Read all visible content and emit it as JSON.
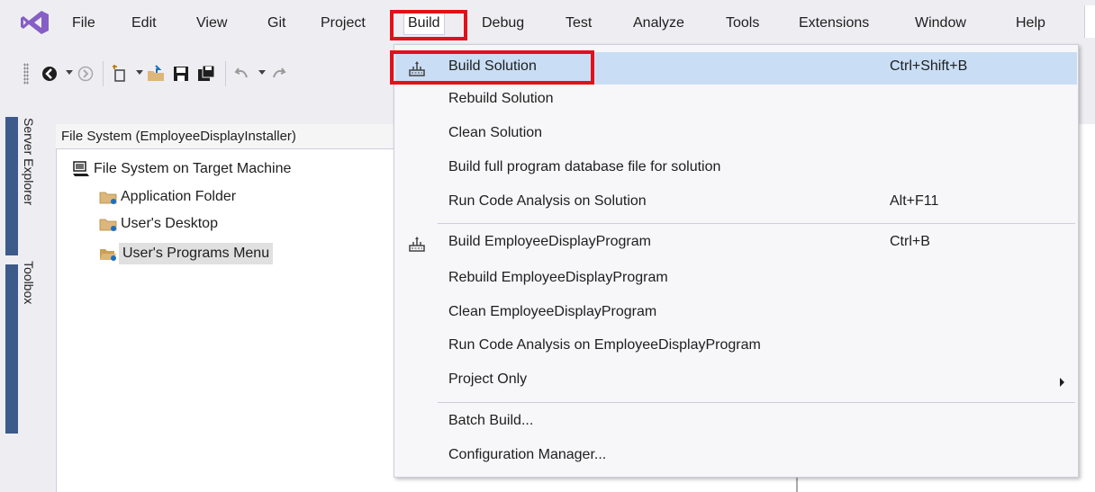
{
  "menubar": {
    "items": [
      {
        "label": "File"
      },
      {
        "label": "Edit"
      },
      {
        "label": "View"
      },
      {
        "label": "Git"
      },
      {
        "label": "Project"
      },
      {
        "label": "Build"
      },
      {
        "label": "Debug"
      },
      {
        "label": "Test"
      },
      {
        "label": "Analyze"
      },
      {
        "label": "Tools"
      },
      {
        "label": "Extensions"
      },
      {
        "label": "Window"
      },
      {
        "label": "Help"
      }
    ],
    "active": "Build"
  },
  "side_tabs": {
    "server_explorer": "Server Explorer",
    "toolbox": "Toolbox"
  },
  "document": {
    "tab_title": "File System (EmployeeDisplayInstaller)",
    "tree": [
      {
        "label": "File System on Target Machine",
        "icon": "computer-icon"
      },
      {
        "label": "Application Folder",
        "icon": "folder-icon"
      },
      {
        "label": "User's Desktop",
        "icon": "folder-icon"
      },
      {
        "label": "User's Programs Menu",
        "icon": "folder-icon",
        "selected": true
      }
    ]
  },
  "build_menu": {
    "items": [
      {
        "label": "Build Solution",
        "shortcut": "Ctrl+Shift+B",
        "icon": "build-icon",
        "highlighted": true
      },
      {
        "label": "Rebuild Solution",
        "shortcut": ""
      },
      {
        "label": "Clean Solution",
        "shortcut": ""
      },
      {
        "label": "Build full program database file for solution",
        "shortcut": ""
      },
      {
        "label": "Run Code Analysis on Solution",
        "shortcut": "Alt+F11"
      },
      {
        "label": "Build EmployeeDisplayProgram",
        "shortcut": "Ctrl+B",
        "icon": "build-icon"
      },
      {
        "label": "Rebuild EmployeeDisplayProgram",
        "shortcut": ""
      },
      {
        "label": "Clean EmployeeDisplayProgram",
        "shortcut": ""
      },
      {
        "label": "Run Code Analysis on EmployeeDisplayProgram",
        "shortcut": ""
      },
      {
        "label": "Project Only",
        "shortcut": "",
        "submenu": true
      },
      {
        "label": "Batch Build...",
        "shortcut": ""
      },
      {
        "label": "Configuration Manager...",
        "shortcut": ""
      }
    ]
  },
  "colors": {
    "highlight_box": "#e3101a",
    "menu_hover": "#c9def5",
    "vs_purple": "#865fc5"
  }
}
